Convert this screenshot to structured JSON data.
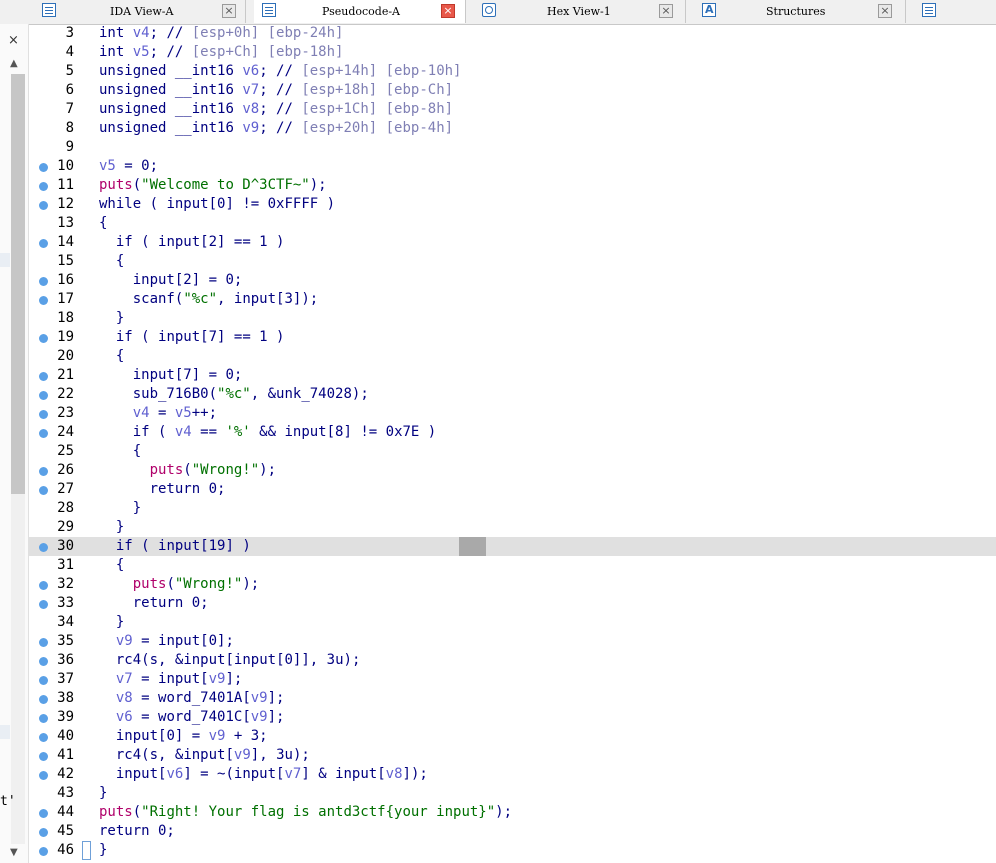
{
  "tabs": [
    {
      "label": "IDA View-A",
      "icon": "listing-icon",
      "active": false
    },
    {
      "label": "Pseudocode-A",
      "icon": "listing-icon",
      "active": true
    },
    {
      "label": "Hex View-1",
      "icon": "hex-icon",
      "active": false
    },
    {
      "label": "Structures",
      "icon": "structures-icon",
      "active": false
    }
  ],
  "tab_close_glyph": "×",
  "left_panel": {
    "close_glyph": "×",
    "partial_char": "t'"
  },
  "colors": {
    "keyword": "#000080",
    "variable": "#6060d0",
    "comment": "#7f7fb4",
    "function": "#b0006a",
    "string": "#007000",
    "breakpoint": "#5aa0e6",
    "highlight": "#e0e0e0"
  },
  "code_lines": [
    {
      "n": "3",
      "bp": false,
      "text": "int v4; // [esp+0h] [ebp-24h]"
    },
    {
      "n": "4",
      "bp": false,
      "text": "int v5; // [esp+Ch] [ebp-18h]"
    },
    {
      "n": "5",
      "bp": false,
      "text": "unsigned __int16 v6; // [esp+14h] [ebp-10h]"
    },
    {
      "n": "6",
      "bp": false,
      "text": "unsigned __int16 v7; // [esp+18h] [ebp-Ch]"
    },
    {
      "n": "7",
      "bp": false,
      "text": "unsigned __int16 v8; // [esp+1Ch] [ebp-8h]"
    },
    {
      "n": "8",
      "bp": false,
      "text": "unsigned __int16 v9; // [esp+20h] [ebp-4h]"
    },
    {
      "n": "9",
      "bp": false,
      "text": ""
    },
    {
      "n": "10",
      "bp": true,
      "text": "v5 = 0;"
    },
    {
      "n": "11",
      "bp": true,
      "text": "puts(\"Welcome to D^3CTF~\");"
    },
    {
      "n": "12",
      "bp": true,
      "text": "while ( input[0] != 0xFFFF )"
    },
    {
      "n": "13",
      "bp": false,
      "text": "{"
    },
    {
      "n": "14",
      "bp": true,
      "text": "  if ( input[2] == 1 )"
    },
    {
      "n": "15",
      "bp": false,
      "text": "  {"
    },
    {
      "n": "16",
      "bp": true,
      "text": "    input[2] = 0;"
    },
    {
      "n": "17",
      "bp": true,
      "text": "    scanf(\"%c\", input[3]);"
    },
    {
      "n": "18",
      "bp": false,
      "text": "  }"
    },
    {
      "n": "19",
      "bp": true,
      "text": "  if ( input[7] == 1 )"
    },
    {
      "n": "20",
      "bp": false,
      "text": "  {"
    },
    {
      "n": "21",
      "bp": true,
      "text": "    input[7] = 0;"
    },
    {
      "n": "22",
      "bp": true,
      "text": "    sub_716B0(\"%c\", &unk_74028);"
    },
    {
      "n": "23",
      "bp": true,
      "text": "    v4 = v5++;"
    },
    {
      "n": "24",
      "bp": true,
      "text": "    if ( v4 == '%' && input[8] != 0x7E )"
    },
    {
      "n": "25",
      "bp": false,
      "text": "    {"
    },
    {
      "n": "26",
      "bp": true,
      "text": "      puts(\"Wrong!\");"
    },
    {
      "n": "27",
      "bp": true,
      "text": "      return 0;"
    },
    {
      "n": "28",
      "bp": false,
      "text": "    }"
    },
    {
      "n": "29",
      "bp": false,
      "text": "  }"
    },
    {
      "n": "30",
      "bp": true,
      "text": "  if ( input[19] )"
    },
    {
      "n": "31",
      "bp": false,
      "text": "  {"
    },
    {
      "n": "32",
      "bp": true,
      "text": "    puts(\"Wrong!\");"
    },
    {
      "n": "33",
      "bp": true,
      "text": "    return 0;"
    },
    {
      "n": "34",
      "bp": false,
      "text": "  }"
    },
    {
      "n": "35",
      "bp": true,
      "text": "  v9 = input[0];"
    },
    {
      "n": "36",
      "bp": true,
      "text": "  rc4(s, &input[input[0]], 3u);"
    },
    {
      "n": "37",
      "bp": true,
      "text": "  v7 = input[v9];"
    },
    {
      "n": "38",
      "bp": true,
      "text": "  v8 = word_7401A[v9];"
    },
    {
      "n": "39",
      "bp": true,
      "text": "  v6 = word_7401C[v9];"
    },
    {
      "n": "40",
      "bp": true,
      "text": "  input[0] = v9 + 3;"
    },
    {
      "n": "41",
      "bp": true,
      "text": "  rc4(s, &input[v9], 3u);"
    },
    {
      "n": "42",
      "bp": true,
      "text": "  input[v6] = ~(input[v7] & input[v8]);"
    },
    {
      "n": "43",
      "bp": false,
      "text": "}"
    },
    {
      "n": "44",
      "bp": true,
      "text": "puts(\"Right! Your flag is antd3ctf{your input}\");"
    },
    {
      "n": "45",
      "bp": true,
      "text": "return 0;"
    },
    {
      "n": "46",
      "bp": true,
      "text": "}"
    }
  ],
  "highlighted_line": "30"
}
